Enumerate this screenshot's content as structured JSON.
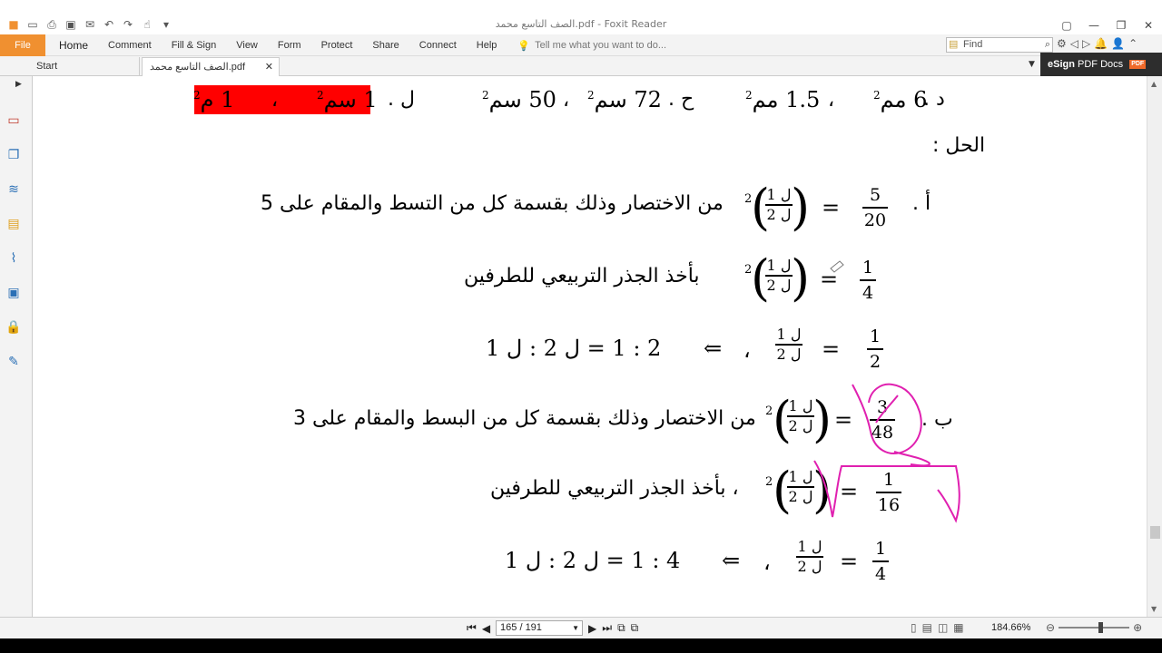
{
  "window": {
    "title": "الصف التاسع محمد.pdf - Foxit Reader",
    "controls": [
      "restore-layout",
      "minimize",
      "maximize",
      "close"
    ]
  },
  "ribbon": {
    "file_label": "File",
    "tabs": [
      "Home",
      "Comment",
      "Fill & Sign",
      "View",
      "Form",
      "Protect",
      "Share",
      "Connect",
      "Help"
    ],
    "tell_me": "Tell me what you want to do...",
    "find_placeholder": "Find"
  },
  "doc_tabs": {
    "start_label": "Start",
    "active_label": "الصف التاسع محمد.pdf",
    "esign_label": "eSign",
    "esign_sub": "PDF Docs",
    "esign_badge": "PDF"
  },
  "status": {
    "page_value": "165 / 191",
    "zoom_value": "184.66%"
  },
  "document": {
    "top_row": {
      "d_label": "د .",
      "d_val1": "6 مم",
      "sep1": "،",
      "d_val2": "1.5 مم",
      "h_label": "ح .",
      "h_val1": "72 سم",
      "sep2": "،",
      "h_val2": "50 سم",
      "l_label": "ل .",
      "l_val1": "1 سم",
      "sep3": "،",
      "l_val2": "1 م",
      "power": "2"
    },
    "solution_label": "الحل :",
    "part_a": {
      "label": "أ .",
      "frac1_num": "5",
      "frac1_den": "20",
      "eq": "=",
      "ratio_num": "ل 1",
      "ratio_den": "ل 2",
      "power": "2",
      "text": "من الاختصار وذلك بقسمة كل من التسط والمقام على 5",
      "frac2_num": "1",
      "frac2_den": "4",
      "text2": "بأخذ الجذر التربيعي للطرفين",
      "frac3_num": "1",
      "frac3_den": "2",
      "result": "2 : 1 = ل 2 : ل 1",
      "implies": "⇐",
      "comma": "،"
    },
    "part_b": {
      "label": "ب .",
      "frac1_num": "3",
      "frac1_den": "48",
      "eq": "=",
      "ratio_num": "ل 1",
      "ratio_den": "ل 2",
      "power": "2",
      "text": "من الاختصار وذلك بقسمة كل من البسط والمقام على 3",
      "frac2_num": "1",
      "frac2_den": "16",
      "text2": "، بأخذ الجذر التربيعي للطرفين",
      "frac3_num": "1",
      "frac3_den": "4",
      "result": "4 : 1 = ل 2 : ل 1",
      "implies": "⇐",
      "comma": "،"
    }
  },
  "colors": {
    "file_tab": "#f09030",
    "highlight": "#ff0000",
    "ink": "#e020b0",
    "esign_bg": "#2d2d2d"
  }
}
